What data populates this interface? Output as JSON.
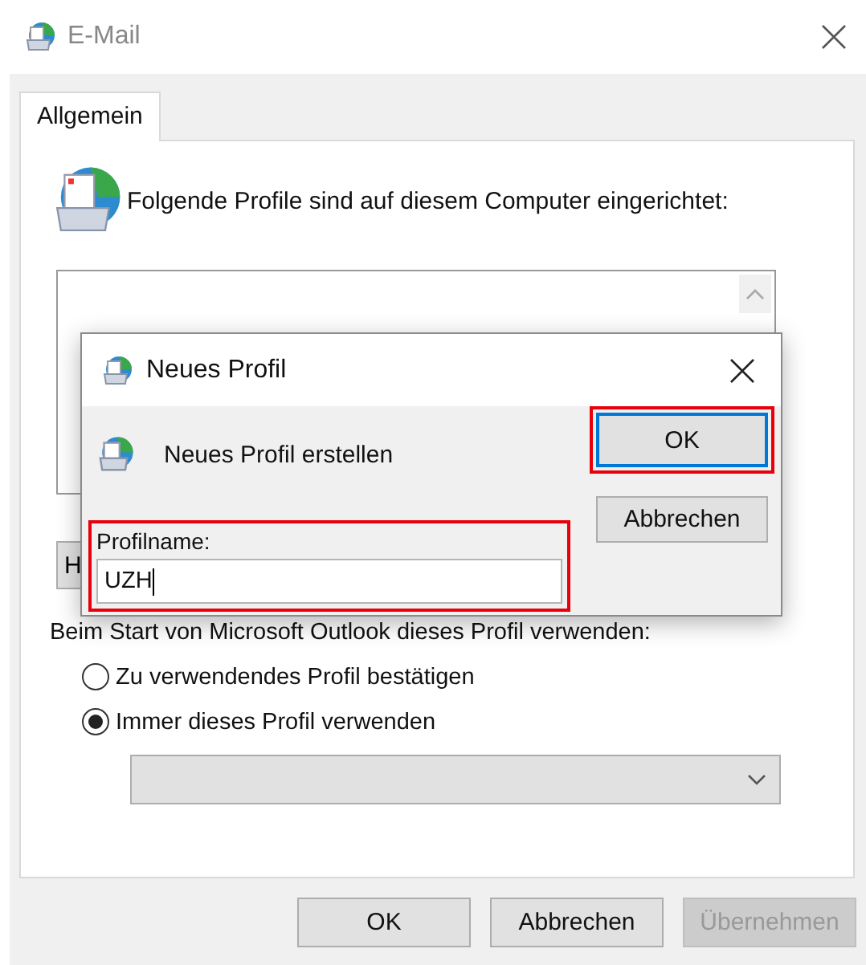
{
  "window": {
    "title": "E-Mail"
  },
  "tabs": [
    {
      "label": "Allgemein",
      "selected": true
    }
  ],
  "intro": "Folgende Profile sind auf diesem Computer eingerichtet:",
  "side_button": {
    "label": "H"
  },
  "startup": {
    "label": "Beim Start von Microsoft Outlook dieses Profil verwenden:",
    "options": [
      {
        "label": "Zu verwendendes Profil bestätigen",
        "selected": false
      },
      {
        "label": "Immer dieses Profil verwenden",
        "selected": true
      }
    ]
  },
  "buttons": [
    {
      "label": "OK",
      "disabled": false
    },
    {
      "label": "Abbrechen",
      "disabled": false
    },
    {
      "label": "Übernehmen",
      "disabled": true
    }
  ],
  "dialog": {
    "title": "Neues Profil",
    "heading": "Neues Profil erstellen",
    "field": {
      "label": "Profilname:",
      "value": "UZH",
      "highlighted": true
    },
    "buttons": [
      {
        "label": "OK",
        "default": true,
        "highlighted": true
      },
      {
        "label": "Abbrechen",
        "default": false,
        "highlighted": false
      }
    ]
  }
}
